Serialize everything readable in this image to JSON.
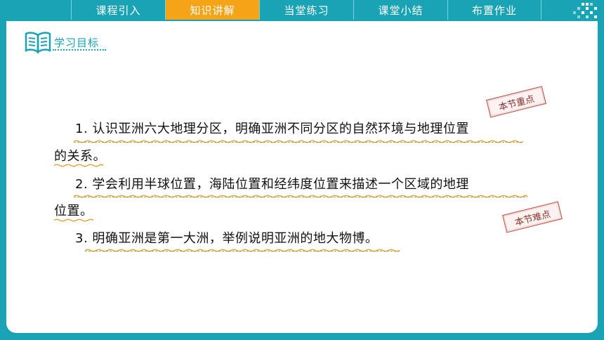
{
  "nav": {
    "tabs": [
      {
        "label": "课程引入"
      },
      {
        "label": "知识讲解"
      },
      {
        "label": "当堂练习"
      },
      {
        "label": "课堂小结"
      },
      {
        "label": "布置作业"
      }
    ],
    "active_index": 1
  },
  "section": {
    "icon": "open-book-icon",
    "title": "学习目标"
  },
  "objectives": {
    "item1_line1": "1. 认识亚洲六大地理分区，明确亚洲不同分区的自然环境与地理位置",
    "item1_line2": "的关系。",
    "item2_line1": "2. 学会利用半球位置，海陆位置和经纬度位置来描述一个区域的地理",
    "item2_line2": "位置。",
    "item3_line1": "3. 明确亚洲是第一大洲，举例说明亚洲的地大物博。"
  },
  "stamps": {
    "key_point": "本节重点",
    "difficult_point": "本节难点"
  },
  "colors": {
    "primary": "#1aa3b4",
    "active_tab": "#f4a416",
    "underline_orange": "#e8a33a",
    "underline_green": "#6a9a3a",
    "stamp_red": "#b7473f"
  }
}
